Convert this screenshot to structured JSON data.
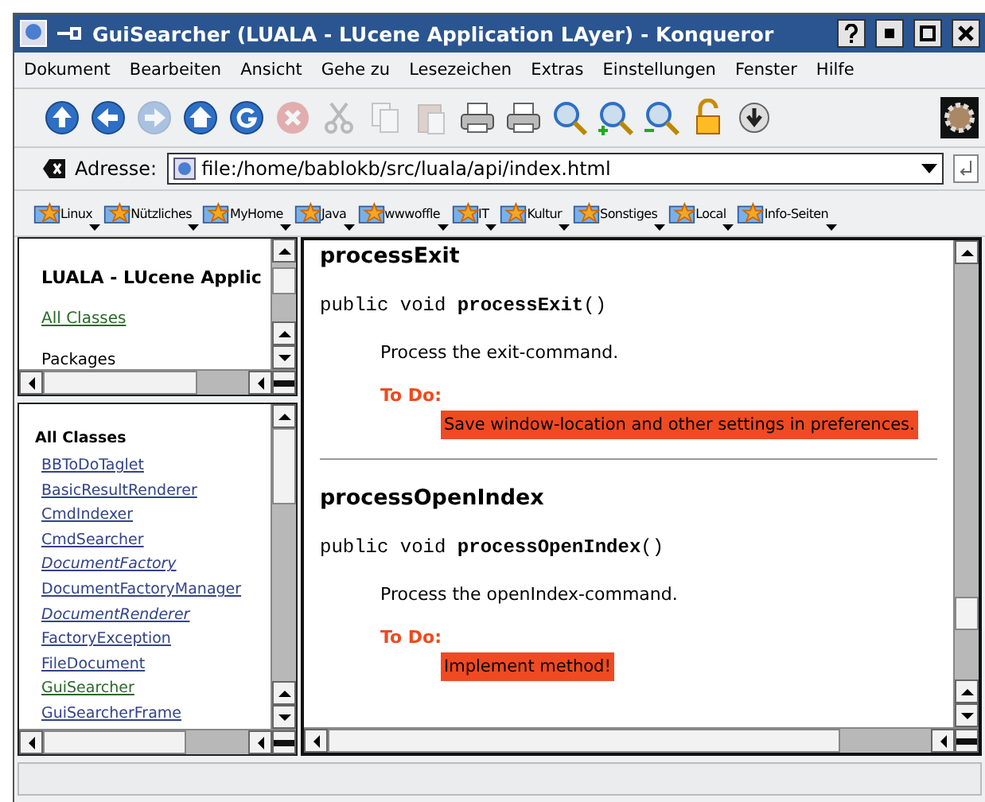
{
  "window": {
    "title": "GuiSearcher (LUALA - LUcene Application LAyer) - Konqueror"
  },
  "menu": [
    "Dokument",
    "Bearbeiten",
    "Ansicht",
    "Gehe zu",
    "Lesezeichen",
    "Extras",
    "Einstellungen",
    "Fenster",
    "Hilfe"
  ],
  "toolbar": [
    {
      "kind": "up",
      "disabled": false
    },
    {
      "kind": "back",
      "disabled": false
    },
    {
      "kind": "forward",
      "disabled": true
    },
    {
      "kind": "home",
      "disabled": false
    },
    {
      "kind": "reload",
      "disabled": false
    },
    {
      "kind": "stop",
      "disabled": true
    },
    {
      "kind": "cut",
      "disabled": true
    },
    {
      "kind": "copy",
      "disabled": true
    },
    {
      "kind": "paste",
      "disabled": true
    },
    {
      "kind": "print",
      "disabled": false
    },
    {
      "kind": "print",
      "disabled": false
    },
    {
      "kind": "find",
      "disabled": false
    },
    {
      "kind": "zoom-in",
      "disabled": false
    },
    {
      "kind": "zoom-out",
      "disabled": false
    },
    {
      "kind": "lock",
      "disabled": false
    },
    {
      "kind": "download",
      "disabled": false
    }
  ],
  "address": {
    "label": "Adresse:",
    "value": "file:/home/bablokb/src/luala/api/index.html"
  },
  "bookmarks": [
    "Linux",
    "Nützliches",
    "MyHome",
    "Java",
    "wwwoffle",
    "IT",
    "Kultur",
    "Sonstiges",
    "Local",
    "Info-Seiten"
  ],
  "overview_frame": {
    "title": "LUALA - LUcene Applic",
    "link": "All Classes",
    "section": "Packages"
  },
  "classes_frame": {
    "heading": "All Classes",
    "items": [
      {
        "name": "BBToDoTaglet",
        "italic": false,
        "visited": false
      },
      {
        "name": "BasicResultRenderer",
        "italic": false,
        "visited": false
      },
      {
        "name": "CmdIndexer",
        "italic": false,
        "visited": false
      },
      {
        "name": "CmdSearcher",
        "italic": false,
        "visited": false
      },
      {
        "name": "DocumentFactory",
        "italic": true,
        "visited": false
      },
      {
        "name": "DocumentFactoryManager",
        "italic": false,
        "visited": false
      },
      {
        "name": "DocumentRenderer",
        "italic": true,
        "visited": false
      },
      {
        "name": "FactoryException",
        "italic": false,
        "visited": false
      },
      {
        "name": "FileDocument",
        "italic": false,
        "visited": false
      },
      {
        "name": "GuiSearcher",
        "italic": false,
        "visited": true
      },
      {
        "name": "GuiSearcherFrame",
        "italic": false,
        "visited": false
      }
    ]
  },
  "methods": [
    {
      "name": "processExit",
      "signature": "public void **processExit**()",
      "description": "Process the exit-command.",
      "todo_label": "To Do:",
      "todo": "Save window-location and other settings in preferences."
    },
    {
      "name": "processOpenIndex",
      "signature": "public void **processOpenIndex**()",
      "description": "Process the openIndex-command.",
      "todo_label": "To Do:",
      "todo": "Implement method!"
    }
  ]
}
